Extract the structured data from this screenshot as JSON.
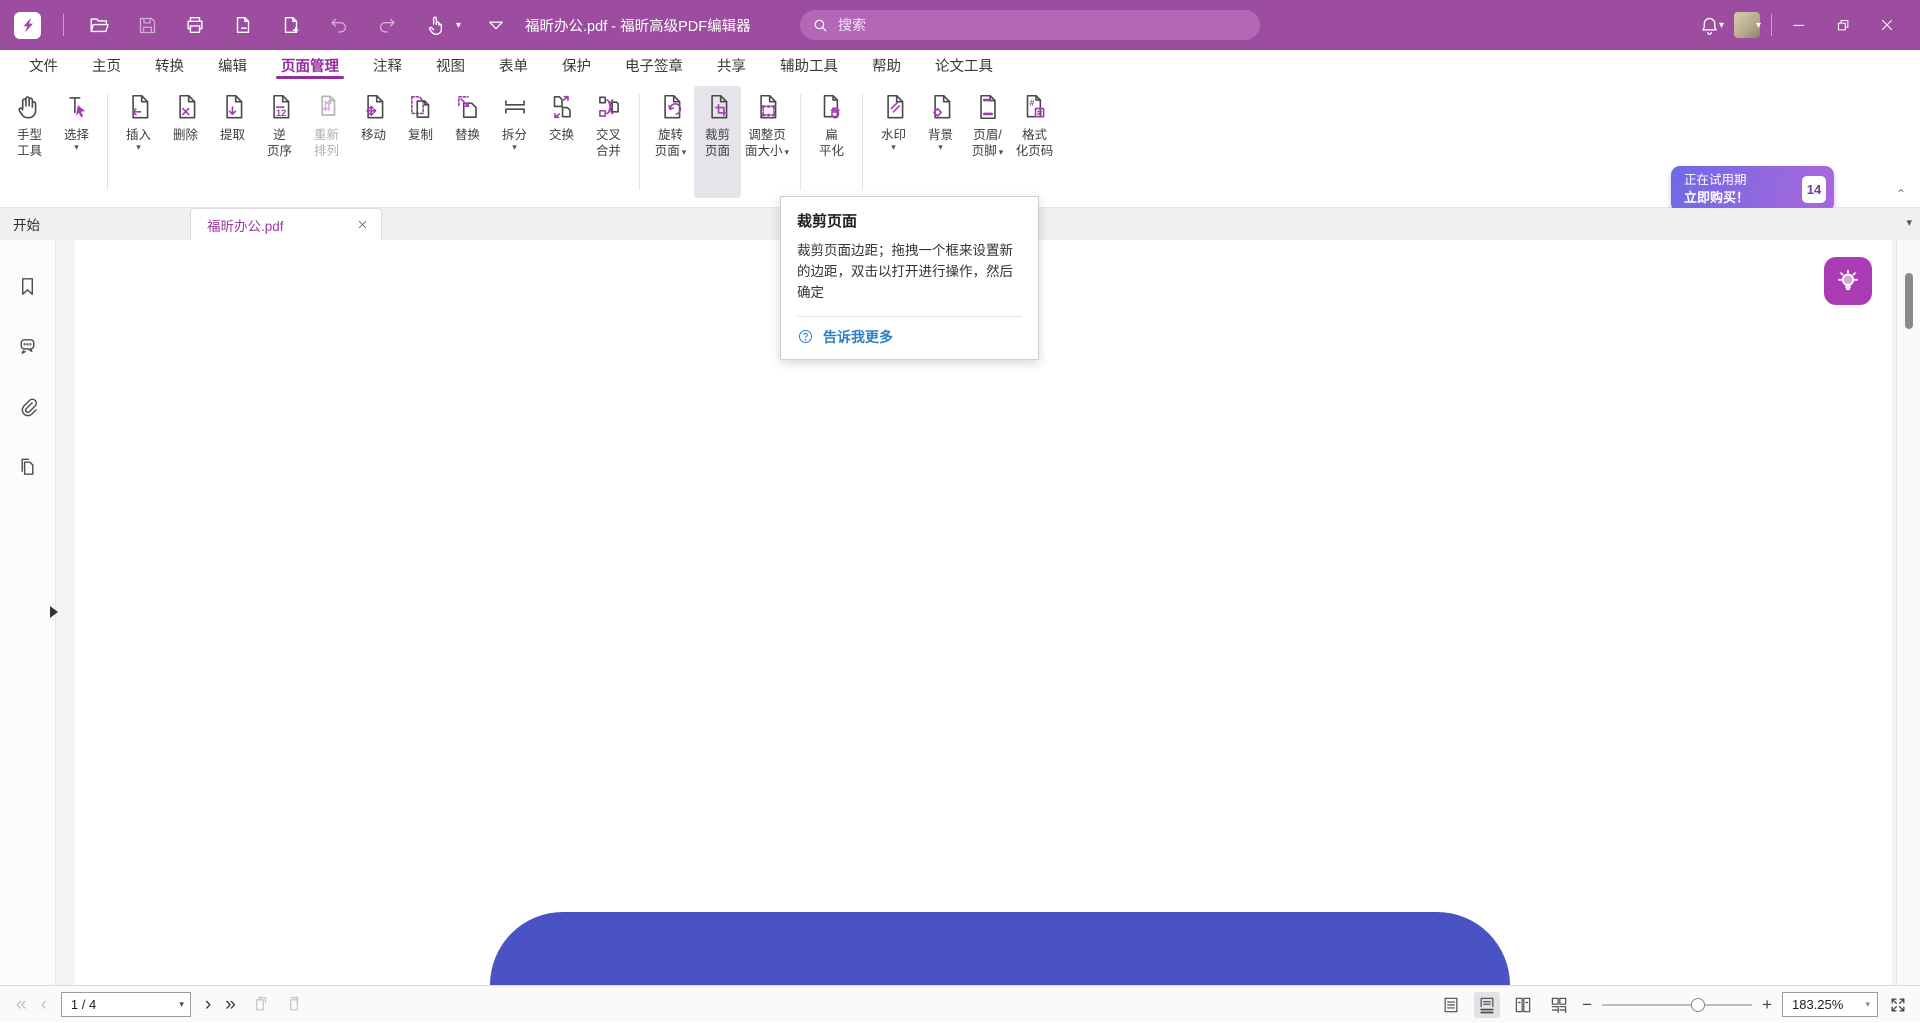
{
  "app": {
    "title": "福昕办公.pdf - 福昕高级PDF编辑器"
  },
  "titlebar": {
    "search_placeholder": "搜索"
  },
  "menubar": {
    "active_id": "page-manage",
    "items": [
      {
        "id": "file",
        "label": "文件"
      },
      {
        "id": "home",
        "label": "主页"
      },
      {
        "id": "convert",
        "label": "转换"
      },
      {
        "id": "edit",
        "label": "编辑"
      },
      {
        "id": "page-manage",
        "label": "页面管理"
      },
      {
        "id": "comment",
        "label": "注释"
      },
      {
        "id": "view",
        "label": "视图"
      },
      {
        "id": "form",
        "label": "表单"
      },
      {
        "id": "protect",
        "label": "保护"
      },
      {
        "id": "esign",
        "label": "电子签章"
      },
      {
        "id": "share",
        "label": "共享"
      },
      {
        "id": "accessibility",
        "label": "辅助工具"
      },
      {
        "id": "help",
        "label": "帮助"
      },
      {
        "id": "paper-tools",
        "label": "论文工具"
      }
    ]
  },
  "ribbon": {
    "groups": [
      [
        {
          "id": "hand-tool",
          "icon": "hand",
          "lines": [
            "手型",
            "工具"
          ]
        },
        {
          "id": "select-tool",
          "icon": "select",
          "lines": [
            "选择"
          ],
          "caret": "below"
        }
      ],
      [
        {
          "id": "insert-page",
          "icon": "insert",
          "lines": [
            "插入"
          ],
          "caret": "below"
        },
        {
          "id": "delete-page",
          "icon": "delete",
          "lines": [
            "删除"
          ]
        },
        {
          "id": "extract-page",
          "icon": "extract",
          "lines": [
            "提取"
          ]
        },
        {
          "id": "reverse-order",
          "icon": "reverse",
          "lines": [
            "逆",
            "页序"
          ]
        },
        {
          "id": "rearrange",
          "icon": "rearrange",
          "lines": [
            "重新",
            "排列"
          ],
          "state": "disabled"
        },
        {
          "id": "move-page",
          "icon": "move",
          "lines": [
            "移动"
          ]
        },
        {
          "id": "copy-page",
          "icon": "copy",
          "lines": [
            "复制"
          ]
        },
        {
          "id": "replace-page",
          "icon": "replace",
          "lines": [
            "替换"
          ]
        },
        {
          "id": "split",
          "icon": "split",
          "lines": [
            "拆分"
          ],
          "caret": "below"
        },
        {
          "id": "swap-page",
          "icon": "swap",
          "lines": [
            "交换"
          ]
        },
        {
          "id": "cross-merge",
          "icon": "crossmerge",
          "lines": [
            "交叉",
            "合并"
          ]
        }
      ],
      [
        {
          "id": "rotate-page",
          "icon": "rotate",
          "lines": [
            "旋转",
            "页面"
          ],
          "caret": "inline"
        },
        {
          "id": "crop-page",
          "icon": "crop",
          "lines": [
            "裁剪",
            "页面"
          ],
          "state": "selected"
        },
        {
          "id": "resize-page",
          "icon": "resize",
          "lines": [
            "调整页",
            "面大小"
          ],
          "caret": "inline"
        }
      ],
      [
        {
          "id": "flatten",
          "icon": "flatten",
          "lines": [
            "扁",
            "平化"
          ]
        }
      ],
      [
        {
          "id": "watermark",
          "icon": "watermark",
          "lines": [
            "水印"
          ],
          "caret": "below"
        },
        {
          "id": "background",
          "icon": "background",
          "lines": [
            "背景"
          ],
          "caret": "below"
        },
        {
          "id": "header-footer",
          "icon": "headerfooter",
          "lines": [
            "页眉/",
            "页脚"
          ],
          "caret": "inline"
        },
        {
          "id": "format-page-number",
          "icon": "formatpage",
          "lines": [
            "格式",
            "化页码"
          ]
        }
      ]
    ],
    "trial": {
      "line1": "正在试用期",
      "line2": "立即购买！",
      "days": "14"
    }
  },
  "tabs": {
    "start_label": "开始",
    "doc_label": "福昕办公.pdf"
  },
  "tooltip": {
    "title": "裁剪页面",
    "body": "裁剪页面边距；拖拽一个框来设置新的边距，双击以打开进行操作，然后确定",
    "link": "告诉我更多"
  },
  "sidebar": {
    "items": [
      {
        "id": "bookmarks",
        "icon": "bookmark"
      },
      {
        "id": "comments",
        "icon": "comment"
      },
      {
        "id": "attachments",
        "icon": "paperclip"
      },
      {
        "id": "pages",
        "icon": "pages"
      }
    ]
  },
  "statusbar": {
    "page_indicator": "1 / 4",
    "zoom_level": "183.25%"
  },
  "glyphs": {
    "caret_down": "▾",
    "first_page": "«",
    "prev_page": "‹",
    "next_page": "›",
    "last_page": "»",
    "minus": "−",
    "plus": "+",
    "collapse_ribbon": "⌃"
  },
  "colors": {
    "titlebar_purple": "#9c4da0",
    "accent_purple": "#a23ead",
    "active_menu": "#942d9e",
    "trial_gradient_start": "#6e6ae5",
    "trial_gradient_end": "#a768dc",
    "link_blue": "#2d7fc9",
    "doc_shape_blue": "#4a53c3"
  }
}
